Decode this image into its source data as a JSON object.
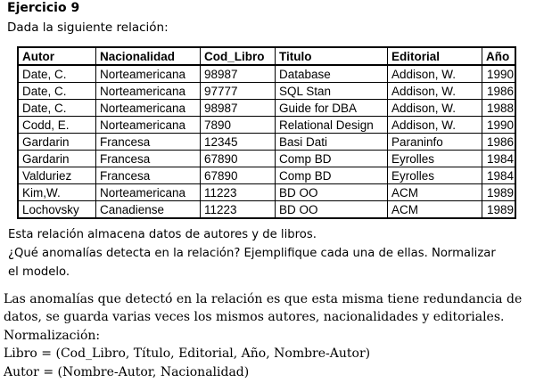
{
  "exercise": {
    "title": "Ejercicio 9",
    "subtitle": "Dada la siguiente relación:"
  },
  "table": {
    "headers": [
      "Autor",
      "Nacionalidad",
      "Cod_Libro",
      "Titulo",
      "Editorial",
      "Año"
    ],
    "rows": [
      [
        "Date, C.",
        "Norteamericana",
        "98987",
        "Database",
        "Addison, W.",
        "1990"
      ],
      [
        "Date, C.",
        "Norteamericana",
        "97777",
        "SQL Stan",
        "Addison, W.",
        "1986"
      ],
      [
        "Date, C.",
        "Norteamericana",
        "98987",
        "Guide for DBA",
        "Addison, W.",
        "1988"
      ],
      [
        "Codd, E.",
        "Norteamericana",
        "7890",
        "Relational Design",
        "Addison, W.",
        "1990"
      ],
      [
        "Gardarin",
        "Francesa",
        "12345",
        "Basi Dati",
        "Paraninfo",
        "1986"
      ],
      [
        "Gardarin",
        "Francesa",
        "67890",
        "Comp BD",
        "Eyrolles",
        "1984"
      ],
      [
        "Valduriez",
        "Francesa",
        "67890",
        "Comp BD",
        "Eyrolles",
        "1984"
      ],
      [
        "Kim,W.",
        "Norteamericana",
        "11223",
        "BD OO",
        "ACM",
        "1989"
      ],
      [
        "Lochovsky",
        "Canadiense",
        "11223",
        "BD OO",
        "ACM",
        "1989"
      ]
    ]
  },
  "question": {
    "line1": "Esta relación almacena datos de autores y de libros.",
    "line2": "¿Qué anomalías detecta en la relación? Ejemplifique cada una de ellas.  Normalizar",
    "line3": "el modelo."
  },
  "answer": {
    "line1": "Las anomalías que detectó en la relación es que esta misma tiene redundancia de",
    "line2": "datos, se guarda varias veces los mismos autores, nacionalidades y editoriales.",
    "line3": "Normalización:",
    "line4": "Libro = (Cod_Libro, Título, Editorial, Año, Nombre-Autor)",
    "line5": "Autor = (Nombre-Autor, Nacionalidad)"
  }
}
